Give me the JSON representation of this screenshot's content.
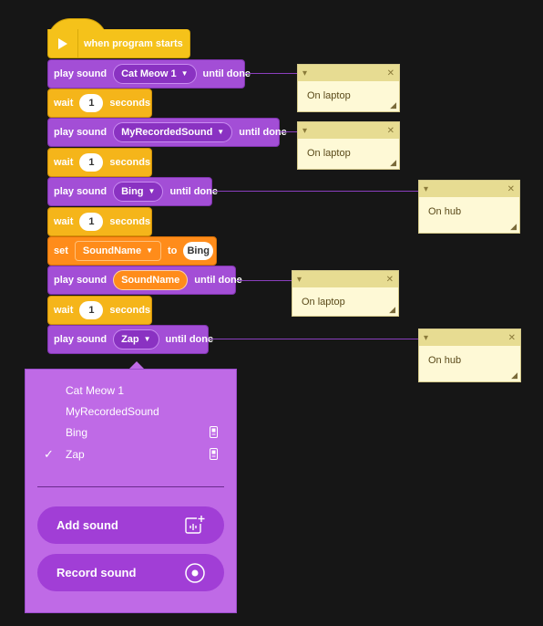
{
  "program": {
    "hat_label": "when program starts",
    "blocks": [
      {
        "kind": "sound",
        "prefix": "play sound",
        "value": "Cat Meow 1",
        "suffix": "until done"
      },
      {
        "kind": "wait",
        "prefix": "wait",
        "value": "1",
        "suffix": "seconds"
      },
      {
        "kind": "sound",
        "prefix": "play sound",
        "value": "MyRecordedSound",
        "suffix": "until done"
      },
      {
        "kind": "wait",
        "prefix": "wait",
        "value": "1",
        "suffix": "seconds"
      },
      {
        "kind": "sound",
        "prefix": "play sound",
        "value": "Bing",
        "suffix": "until done"
      },
      {
        "kind": "wait",
        "prefix": "wait",
        "value": "1",
        "suffix": "seconds"
      },
      {
        "kind": "set",
        "prefix": "set",
        "variable": "SoundName",
        "middle": "to",
        "value": "Bing"
      },
      {
        "kind": "sound-var",
        "prefix": "play sound",
        "value": "SoundName",
        "suffix": "until done"
      },
      {
        "kind": "wait",
        "prefix": "wait",
        "value": "1",
        "suffix": "seconds"
      },
      {
        "kind": "sound",
        "prefix": "play sound",
        "value": "Zap",
        "suffix": "until done"
      }
    ]
  },
  "comments": [
    {
      "text": "On laptop"
    },
    {
      "text": "On laptop"
    },
    {
      "text": "On hub"
    },
    {
      "text": "On laptop"
    },
    {
      "text": "On hub"
    }
  ],
  "dropdown": {
    "options": [
      {
        "label": "Cat Meow 1",
        "checked": false,
        "device_icon": false
      },
      {
        "label": "MyRecordedSound",
        "checked": false,
        "device_icon": false
      },
      {
        "label": "Bing",
        "checked": false,
        "device_icon": true
      },
      {
        "label": "Zap",
        "checked": true,
        "device_icon": true
      }
    ],
    "check_glyph": "✓",
    "add_sound_label": "Add sound",
    "record_sound_label": "Record sound"
  },
  "icons": {
    "comment_collapse": "▾",
    "comment_close": "✕",
    "comment_resize": "◢",
    "dropdown_caret": "▼"
  },
  "colors": {
    "event": "#f5c21a",
    "sound": "#a34ed6",
    "control": "#f5b51a",
    "variable": "#ff8c1a",
    "comment": "#fef9d6",
    "menu": "#bf6ae6"
  }
}
